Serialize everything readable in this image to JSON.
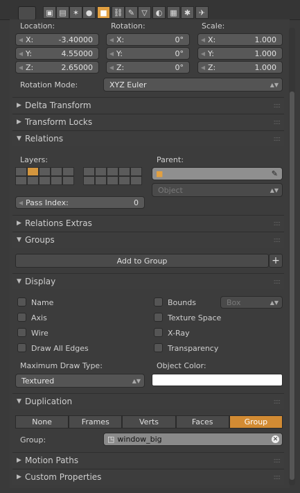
{
  "header": {
    "icons": [
      "object-data-icon",
      "scene-icon",
      "render-layers-icon",
      "world-icon",
      "object-icon",
      "constraints-icon",
      "modifiers-icon",
      "data-icon",
      "material-icon",
      "texture-icon",
      "particles-icon",
      "physics-icon"
    ]
  },
  "transform": {
    "location_label": "Location:",
    "rotation_label": "Rotation:",
    "scale_label": "Scale:",
    "location": [
      {
        "axis": "X:",
        "value": "-3.40000"
      },
      {
        "axis": "Y:",
        "value": "4.55000"
      },
      {
        "axis": "Z:",
        "value": "2.65000"
      }
    ],
    "rotation": [
      {
        "axis": "X:",
        "value": "0°"
      },
      {
        "axis": "Y:",
        "value": "0°"
      },
      {
        "axis": "Z:",
        "value": "0°"
      }
    ],
    "scale": [
      {
        "axis": "X:",
        "value": "1.000"
      },
      {
        "axis": "Y:",
        "value": "1.000"
      },
      {
        "axis": "Z:",
        "value": "1.000"
      }
    ],
    "rotation_mode_label": "Rotation Mode:",
    "rotation_mode_value": "XYZ Euler"
  },
  "sections": {
    "delta": "Delta Transform",
    "locks": "Transform Locks",
    "relations": "Relations",
    "relations_extras": "Relations Extras",
    "groups": "Groups",
    "display": "Display",
    "duplication": "Duplication",
    "motion_paths": "Motion Paths",
    "custom_props": "Custom Properties"
  },
  "relations": {
    "layers_label": "Layers:",
    "parent_label": "Parent:",
    "parent_type_placeholder": "Object",
    "pass_index_label": "Pass Index:",
    "pass_index_value": "0"
  },
  "groups": {
    "add_label": "Add to Group",
    "plus": "+"
  },
  "display": {
    "left": [
      "Name",
      "Axis",
      "Wire",
      "Draw All Edges"
    ],
    "right": [
      "Bounds",
      "Texture Space",
      "X-Ray",
      "Transparency"
    ],
    "bounds_type": "Box",
    "max_draw_label": "Maximum Draw Type:",
    "max_draw_value": "Textured",
    "obj_color_label": "Object Color:",
    "obj_color": "#ffffff"
  },
  "duplication": {
    "options": [
      "None",
      "Frames",
      "Verts",
      "Faces",
      "Group"
    ],
    "selected": "Group",
    "group_label": "Group:",
    "group_value": "window_big"
  },
  "colors": {
    "accent": "#d28b33",
    "panel": "#3c3c3c"
  }
}
